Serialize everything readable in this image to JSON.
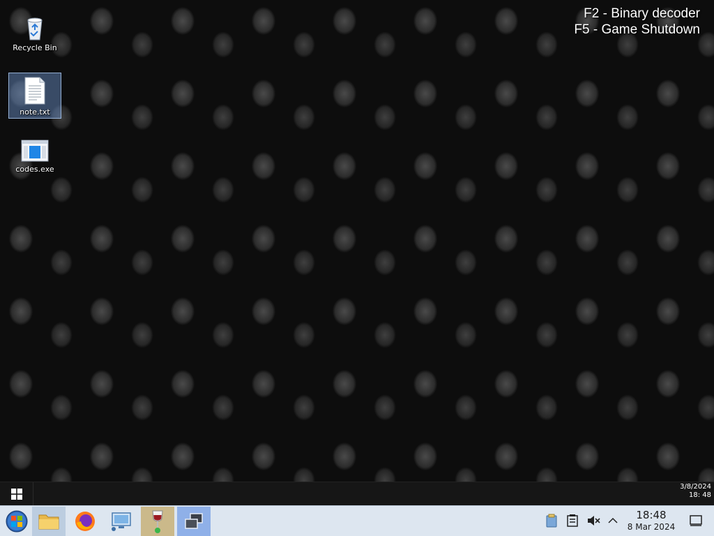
{
  "desktop": {
    "icons": [
      {
        "label": "Recycle Bin",
        "icon": "recycle-bin-icon"
      },
      {
        "label": "note.txt",
        "icon": "text-file-icon",
        "selected": true
      },
      {
        "label": "codes.exe",
        "icon": "executable-icon"
      }
    ],
    "hints": [
      "F2 - Binary decoder",
      "F5 - Game Shutdown"
    ]
  },
  "inner_taskbar": {
    "start_icon": "windows-logo-icon",
    "date": "3/8/2024",
    "time": "18: 48"
  },
  "host_taskbar": {
    "apps": [
      {
        "name": "start",
        "icon": "start-orb-icon"
      },
      {
        "name": "files",
        "icon": "folder-icon",
        "active": true
      },
      {
        "name": "firefox",
        "icon": "firefox-icon"
      },
      {
        "name": "network",
        "icon": "network-monitor-icon"
      },
      {
        "name": "wine",
        "icon": "wine-glass-icon",
        "active": true
      },
      {
        "name": "vm",
        "icon": "virtual-machine-icon",
        "active": true
      }
    ],
    "tray": [
      "clipboard-icon",
      "notes-icon",
      "speaker-muted-icon",
      "chevron-up-icon"
    ],
    "time": "18:48",
    "date": "8 Mar 2024",
    "notify_icon": "notification-icon"
  },
  "colors": {
    "host_taskbar_bg": "#dde6f0",
    "inner_taskbar_bg": "#161616",
    "selection": "#6e96d2"
  }
}
